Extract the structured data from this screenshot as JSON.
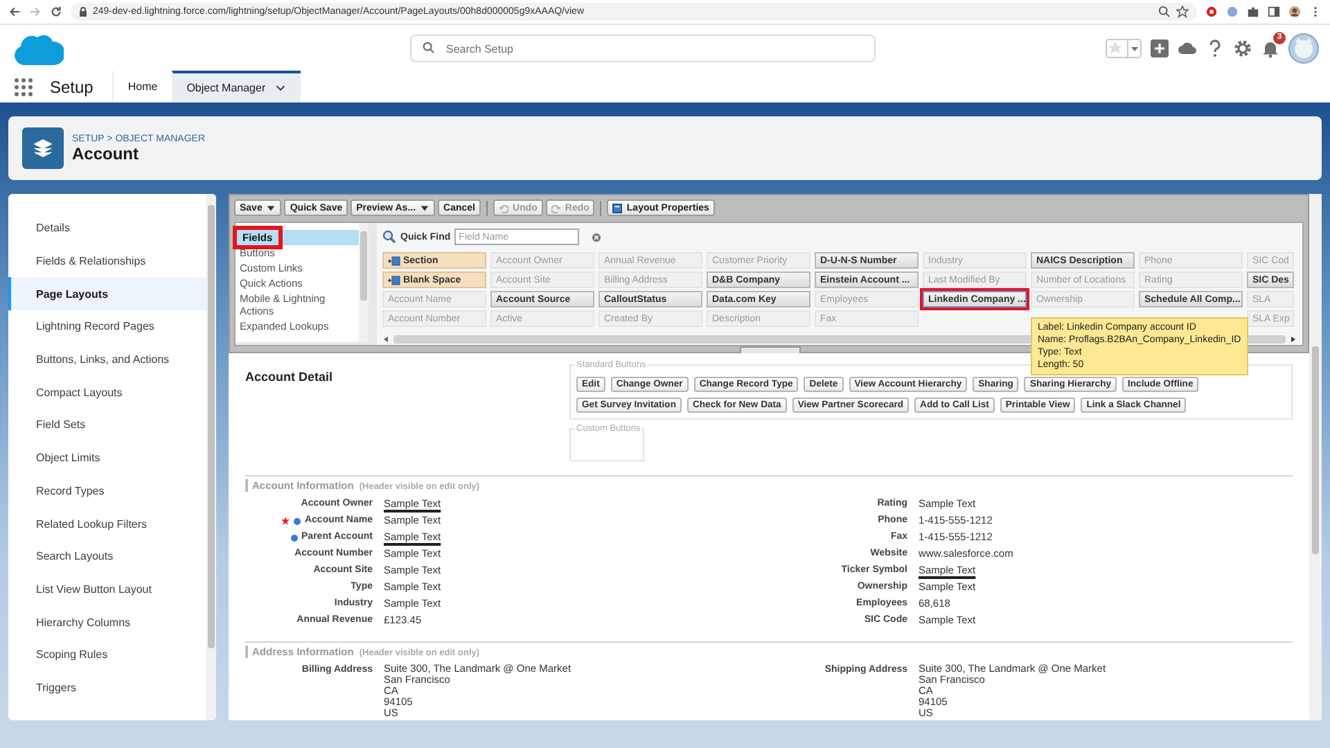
{
  "browser": {
    "url": "249-dev-ed.lightning.force.com/lightning/setup/ObjectManager/Account/PageLayouts/00h8d000005g9xAAAQ/view"
  },
  "header": {
    "search": {
      "placeholder": "Search Setup"
    },
    "notification_count": "3"
  },
  "nav": {
    "app_name": "Setup",
    "tabs": [
      {
        "label": "Home",
        "selected": false
      },
      {
        "label": "Object Manager",
        "selected": true
      }
    ]
  },
  "page_header": {
    "breadcrumb": "SETUP > OBJECT MANAGER",
    "title": "Account"
  },
  "sidebar": {
    "items": [
      {
        "label": "Details",
        "selected": false
      },
      {
        "label": "Fields & Relationships",
        "selected": false
      },
      {
        "label": "Page Layouts",
        "selected": true
      },
      {
        "label": "Lightning Record Pages",
        "selected": false
      },
      {
        "label": "Buttons, Links, and Actions",
        "selected": false
      },
      {
        "label": "Compact Layouts",
        "selected": false
      },
      {
        "label": "Field Sets",
        "selected": false
      },
      {
        "label": "Object Limits",
        "selected": false
      },
      {
        "label": "Record Types",
        "selected": false
      },
      {
        "label": "Related Lookup Filters",
        "selected": false
      },
      {
        "label": "Search Layouts",
        "selected": false
      },
      {
        "label": "List View Button Layout",
        "selected": false
      },
      {
        "label": "Hierarchy Columns",
        "selected": false
      },
      {
        "label": "Scoping Rules",
        "selected": false
      },
      {
        "label": "Triggers",
        "selected": false
      }
    ]
  },
  "toolbar": {
    "buttons": [
      {
        "label": "Save",
        "kind": "menu",
        "disabled": false
      },
      {
        "label": "Quick Save",
        "kind": "plain",
        "disabled": false
      },
      {
        "label": "Preview As...",
        "kind": "menu",
        "disabled": false
      },
      {
        "label": "Cancel",
        "kind": "plain",
        "disabled": false
      },
      {
        "label": "Undo",
        "kind": "undo",
        "disabled": true
      },
      {
        "label": "Redo",
        "kind": "redo",
        "disabled": true
      },
      {
        "label": "Layout Properties",
        "kind": "properties",
        "disabled": false
      }
    ]
  },
  "palette": {
    "categories": [
      {
        "label": "Fields",
        "selected": true,
        "highlighted": true
      },
      {
        "label": "Buttons",
        "selected": false,
        "highlighted": false
      },
      {
        "label": "Custom Links",
        "selected": false,
        "highlighted": false
      },
      {
        "label": "Quick Actions",
        "selected": false,
        "highlighted": false
      },
      {
        "label": "Mobile & Lightning Actions",
        "selected": false,
        "highlighted": false
      },
      {
        "label": "Expanded Lookups",
        "selected": false,
        "highlighted": false
      }
    ],
    "quick_find": {
      "label": "Quick Find",
      "placeholder": "Field Name"
    },
    "rows": [
      [
        {
          "label": "Section",
          "kind": "special",
          "highlighted": false
        },
        {
          "label": "Account Owner",
          "kind": "field",
          "used": false,
          "highlighted": false
        },
        {
          "label": "Annual Revenue",
          "kind": "field",
          "used": false,
          "highlighted": false
        },
        {
          "label": "Customer Priority",
          "kind": "field",
          "used": false,
          "highlighted": false
        },
        {
          "label": "D-U-N-S Number",
          "kind": "field",
          "used": true,
          "highlighted": false
        },
        {
          "label": "Industry",
          "kind": "field",
          "used": false,
          "highlighted": false
        },
        {
          "label": "NAICS Description",
          "kind": "field",
          "used": true,
          "highlighted": false
        },
        {
          "label": "Phone",
          "kind": "field",
          "used": false,
          "highlighted": false
        },
        {
          "label": "SIC Cod",
          "kind": "field",
          "used": false,
          "highlighted": false
        }
      ],
      [
        {
          "label": "Blank Space",
          "kind": "special",
          "highlighted": false
        },
        {
          "label": "Account Site",
          "kind": "field",
          "used": false,
          "highlighted": false
        },
        {
          "label": "Billing Address",
          "kind": "field",
          "used": false,
          "highlighted": false
        },
        {
          "label": "D&B Company",
          "kind": "field",
          "used": true,
          "highlighted": false
        },
        {
          "label": "Einstein Account ...",
          "kind": "field",
          "used": true,
          "highlighted": false
        },
        {
          "label": "Last Modified By",
          "kind": "field",
          "used": false,
          "highlighted": false
        },
        {
          "label": "Number of Locations",
          "kind": "field",
          "used": false,
          "highlighted": false
        },
        {
          "label": "Rating",
          "kind": "field",
          "used": false,
          "highlighted": false
        },
        {
          "label": "SIC Des",
          "kind": "field",
          "used": true,
          "highlighted": false
        }
      ],
      [
        {
          "label": "Account Name",
          "kind": "field",
          "used": false,
          "highlighted": false
        },
        {
          "label": "Account Source",
          "kind": "field",
          "used": true,
          "highlighted": false
        },
        {
          "label": "CalloutStatus",
          "kind": "field",
          "used": true,
          "highlighted": false
        },
        {
          "label": "Data.com Key",
          "kind": "field",
          "used": true,
          "highlighted": false
        },
        {
          "label": "Employees",
          "kind": "field",
          "used": false,
          "highlighted": false
        },
        {
          "label": "Linkedin Company ...",
          "kind": "field",
          "used": true,
          "highlighted": true
        },
        {
          "label": "Ownership",
          "kind": "field",
          "used": false,
          "highlighted": false
        },
        {
          "label": "Schedule All Comp...",
          "kind": "field",
          "used": true,
          "highlighted": false
        },
        {
          "label": "SLA",
          "kind": "field",
          "used": false,
          "highlighted": false
        }
      ],
      [
        {
          "label": "Account Number",
          "kind": "field",
          "used": false,
          "highlighted": false
        },
        {
          "label": "Active",
          "kind": "field",
          "used": false,
          "highlighted": false
        },
        {
          "label": "Created By",
          "kind": "field",
          "used": false,
          "highlighted": false
        },
        {
          "label": "Description",
          "kind": "field",
          "used": false,
          "highlighted": false
        },
        {
          "label": "Fax",
          "kind": "field",
          "used": false,
          "highlighted": false
        },
        {
          "kind": "covered"
        },
        {
          "kind": "covered"
        },
        {
          "kind": "covered"
        },
        {
          "label": "SLA Exp",
          "kind": "field",
          "used": false,
          "highlighted": false
        }
      ]
    ],
    "tooltip": {
      "lines": [
        "Label: Linkedin Company account ID",
        "Name: Proflags.B2BAn_Company_Linkedin_ID",
        "Type: Text",
        "Length: 50"
      ]
    }
  },
  "layout": {
    "title": "Account Detail",
    "standard_buttons": {
      "label": "Standard Buttons",
      "buttons": [
        "Edit",
        "Change Owner",
        "Change Record Type",
        "Delete",
        "View Account Hierarchy",
        "Sharing",
        "Sharing Hierarchy",
        "Include Offline",
        "Get Survey Invitation",
        "Check for New Data",
        "View Partner Scorecard",
        "Add to Call List",
        "Printable View",
        "Link a Slack Channel"
      ]
    },
    "custom_buttons": {
      "label": "Custom Buttons"
    },
    "sections": [
      {
        "title": "Account Information",
        "note": "(Header visible on edit only)",
        "rows": [
          [
            {
              "label": "Account Owner",
              "value": "Sample Text",
              "lookup": true,
              "required": false,
              "dot": false
            },
            {
              "label": "Rating",
              "value": "Sample Text",
              "lookup": false,
              "required": false,
              "dot": false
            }
          ],
          [
            {
              "label": "Account Name",
              "value": "Sample Text",
              "lookup": false,
              "required": true,
              "dot": true
            },
            {
              "label": "Phone",
              "value": "1-415-555-1212",
              "lookup": false,
              "required": false,
              "dot": false
            }
          ],
          [
            {
              "label": "Parent Account",
              "value": "Sample Text",
              "lookup": true,
              "required": false,
              "dot": true
            },
            {
              "label": "Fax",
              "value": "1-415-555-1212",
              "lookup": false,
              "required": false,
              "dot": false
            }
          ],
          [
            {
              "label": "Account Number",
              "value": "Sample Text",
              "lookup": false,
              "required": false,
              "dot": false
            },
            {
              "label": "Website",
              "value": "www.salesforce.com",
              "lookup": false,
              "required": false,
              "dot": false
            }
          ],
          [
            {
              "label": "Account Site",
              "value": "Sample Text",
              "lookup": false,
              "required": false,
              "dot": false
            },
            {
              "label": "Ticker Symbol",
              "value": "Sample Text",
              "lookup": true,
              "required": false,
              "dot": false
            }
          ],
          [
            {
              "label": "Type",
              "value": "Sample Text",
              "lookup": false,
              "required": false,
              "dot": false
            },
            {
              "label": "Ownership",
              "value": "Sample Text",
              "lookup": false,
              "required": false,
              "dot": false
            }
          ],
          [
            {
              "label": "Industry",
              "value": "Sample Text",
              "lookup": false,
              "required": false,
              "dot": false
            },
            {
              "label": "Employees",
              "value": "68,618",
              "lookup": false,
              "required": false,
              "dot": false
            }
          ],
          [
            {
              "label": "Annual Revenue",
              "value": "£123.45",
              "lookup": false,
              "required": false,
              "dot": false
            },
            {
              "label": "SIC Code",
              "value": "Sample Text",
              "lookup": false,
              "required": false,
              "dot": false
            }
          ]
        ]
      },
      {
        "title": "Address Information",
        "note": "(Header visible on edit only)",
        "rows": [
          [
            {
              "label": "Billing Address",
              "lines": [
                "Suite 300, The Landmark @ One Market",
                "San Francisco",
                "CA",
                "94105",
                "US"
              ],
              "lookup": false,
              "required": false,
              "dot": false
            },
            {
              "label": "Shipping Address",
              "lines": [
                "Suite 300, The Landmark @ One Market",
                "San Francisco",
                "CA",
                "94105",
                "US"
              ],
              "lookup": false,
              "required": false,
              "dot": false
            }
          ]
        ]
      }
    ]
  }
}
